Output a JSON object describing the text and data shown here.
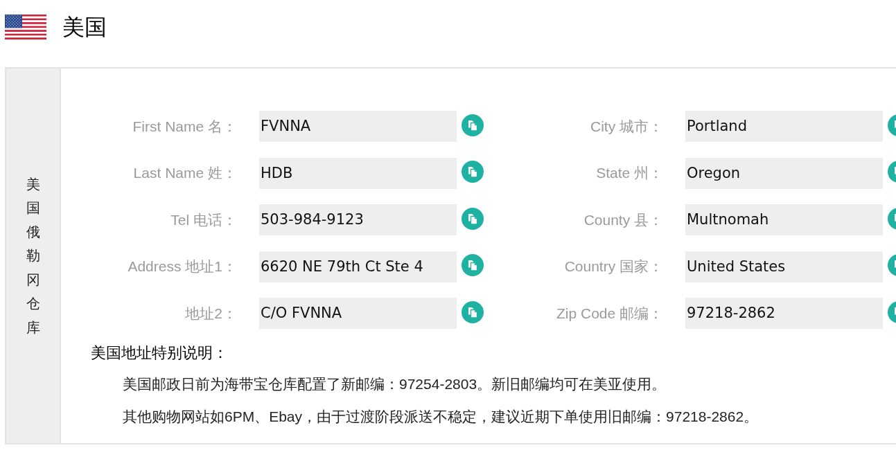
{
  "header": {
    "title": "美国"
  },
  "warehouse": {
    "name": "美国俄勒冈仓库"
  },
  "address": {
    "columns": [
      {
        "fields": [
          {
            "label": "First Name 名：",
            "value": "FVNNA"
          },
          {
            "label": "Last Name 姓：",
            "value": "HDB"
          },
          {
            "label": "Tel 电话：",
            "value": "503-984-9123"
          },
          {
            "label": "Address 地址1：",
            "value": "6620 NE 79th Ct Ste 4"
          },
          {
            "label": "地址2：",
            "value": "C/O FVNNA"
          }
        ]
      },
      {
        "fields": [
          {
            "label": "City 城市：",
            "value": "Portland"
          },
          {
            "label": "State 州：",
            "value": "Oregon"
          },
          {
            "label": "County 县：",
            "value": "Multnomah"
          },
          {
            "label": "Country 国家：",
            "value": "United States"
          },
          {
            "label": "Zip Code 邮编：",
            "value": "97218-2862"
          }
        ]
      }
    ]
  },
  "notes": {
    "heading": "美国地址特别说明：",
    "lines": [
      "美国邮政日前为海带宝仓库配置了新邮编：97254-2803。新旧邮编均可在美亚使用。",
      "其他购物网站如6PM、Ebay，由于过渡阶段派送不稳定，建议近期下单使用旧邮编：97218-2862。"
    ]
  }
}
